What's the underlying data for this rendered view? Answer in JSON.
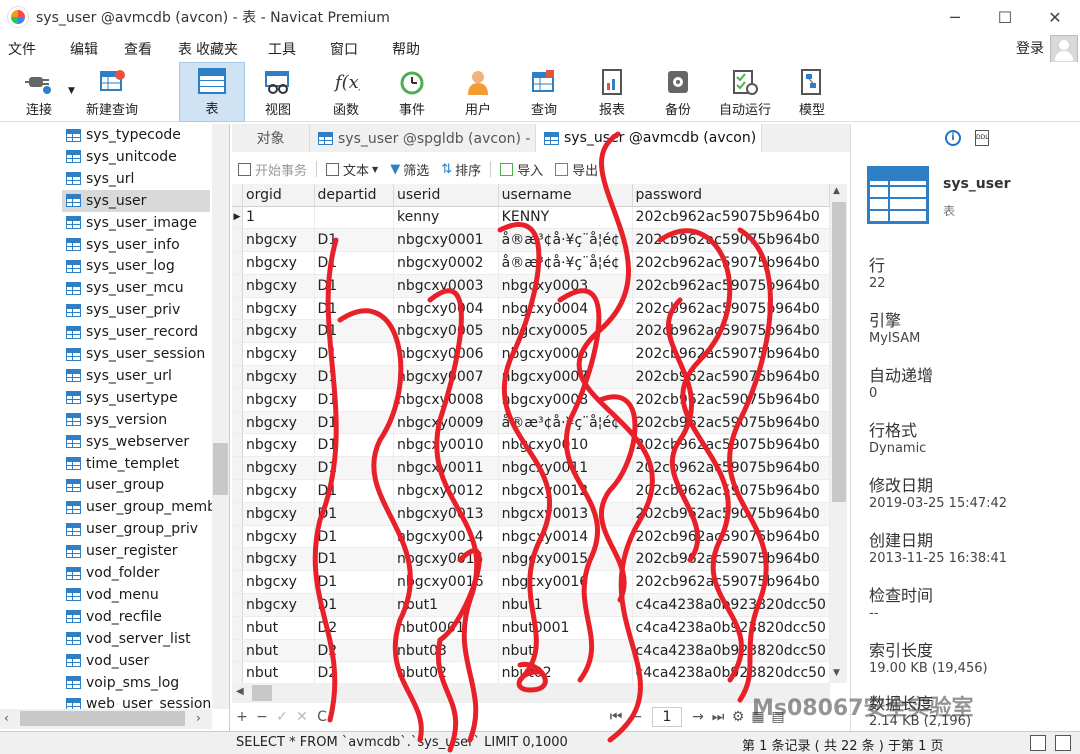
{
  "window": {
    "title": "sys_user @avmcdb (avcon) - 表 - Navicat Premium",
    "controls": [
      "─",
      "☐",
      "✕"
    ]
  },
  "menu": [
    "文件",
    "编辑",
    "查看",
    "表",
    "收藏夹",
    "工具",
    "窗口",
    "帮助"
  ],
  "login_label": "登录",
  "toolbar": [
    {
      "label": "连接",
      "icon": "plug-icon"
    },
    {
      "label": "新建查询",
      "icon": "new-query-icon"
    },
    {
      "label": "表",
      "icon": "table-icon",
      "active": true
    },
    {
      "label": "视图",
      "icon": "view-icon"
    },
    {
      "label": "函数",
      "icon": "function-icon"
    },
    {
      "label": "事件",
      "icon": "clock-icon"
    },
    {
      "label": "用户",
      "icon": "user-icon"
    },
    {
      "label": "查询",
      "icon": "query-icon"
    },
    {
      "label": "报表",
      "icon": "report-icon"
    },
    {
      "label": "备份",
      "icon": "backup-icon"
    },
    {
      "label": "自动运行",
      "icon": "auto-run-icon"
    },
    {
      "label": "模型",
      "icon": "model-icon"
    }
  ],
  "sidebar": {
    "items": [
      "sys_typecode",
      "sys_unitcode",
      "sys_url",
      "sys_user",
      "sys_user_image",
      "sys_user_info",
      "sys_user_log",
      "sys_user_mcu",
      "sys_user_priv",
      "sys_user_record",
      "sys_user_session",
      "sys_user_url",
      "sys_usertype",
      "sys_version",
      "sys_webserver",
      "time_templet",
      "user_group",
      "user_group_memb",
      "user_group_priv",
      "user_register",
      "vod_folder",
      "vod_menu",
      "vod_recfile",
      "vod_server_list",
      "vod_user",
      "voip_sms_log",
      "web_user_session"
    ],
    "selected": "sys_user"
  },
  "tabs": [
    "对象",
    "sys_user @spgldb (avcon) - 表",
    "sys_user @avmcdb (avcon) -..."
  ],
  "data_toolbar": [
    "开始事务",
    "文本",
    "筛选",
    "排序",
    "导入",
    "导出"
  ],
  "grid": {
    "columns": [
      "orgid",
      "departid",
      "userid",
      "username",
      "password"
    ],
    "rows": [
      [
        "1",
        "",
        "kenny",
        "KENNY",
        "202cb962ac59075b964b0"
      ],
      [
        "nbgcxy",
        "D1",
        "nbgcxy0001",
        "å®æ³¢å·¥ç¨å­¦é¢",
        "202cb962ac59075b964b0"
      ],
      [
        "nbgcxy",
        "D1",
        "nbgcxy0002",
        "å®æ³¢å·¥ç¨å­¦é¢",
        "202cb962ac59075b964b0"
      ],
      [
        "nbgcxy",
        "D1",
        "nbgcxy0003",
        "nbgcxy0003",
        "202cb962ac59075b964b0"
      ],
      [
        "nbgcxy",
        "D1",
        "nbgcxy0004",
        "nbgcxy0004",
        "202cb962ac59075b964b0"
      ],
      [
        "nbgcxy",
        "D1",
        "nbgcxy0005",
        "nbgcxy0005",
        "202cb962ac59075b964b0"
      ],
      [
        "nbgcxy",
        "D1",
        "nbgcxy0006",
        "nbgcxy0006",
        "202cb962ac59075b964b0"
      ],
      [
        "nbgcxy",
        "D1",
        "nbgcxy0007",
        "nbgcxy0007",
        "202cb962ac59075b964b0"
      ],
      [
        "nbgcxy",
        "D1",
        "nbgcxy0008",
        "nbgcxy0008",
        "202cb962ac59075b964b0"
      ],
      [
        "nbgcxy",
        "D1",
        "nbgcxy0009",
        "å®æ³¢å·¥ç¨å­¦é¢",
        "202cb962ac59075b964b0"
      ],
      [
        "nbgcxy",
        "D1",
        "nbgcxy0010",
        "nbgcxy0010",
        "202cb962ac59075b964b0"
      ],
      [
        "nbgcxy",
        "D1",
        "nbgcxy0011",
        "nbgcxy0011",
        "202cb962ac59075b964b0"
      ],
      [
        "nbgcxy",
        "D1",
        "nbgcxy0012",
        "nbgcxy0012",
        "202cb962ac59075b964b0"
      ],
      [
        "nbgcxy",
        "D1",
        "nbgcxy0013",
        "nbgcxy0013",
        "202cb962ac59075b964b0"
      ],
      [
        "nbgcxy",
        "D1",
        "nbgcxy0014",
        "nbgcxy0014",
        "202cb962ac59075b964b0"
      ],
      [
        "nbgcxy",
        "D1",
        "nbgcxy0015",
        "nbgcxy0015",
        "202cb962ac59075b964b0"
      ],
      [
        "nbgcxy",
        "D1",
        "nbgcxy0016",
        "nbgcxy0016",
        "202cb962ac59075b964b0"
      ],
      [
        "nbgcxy",
        "D1",
        "nbut1",
        "nbut1",
        "c4ca4238a0b923820dcc50"
      ],
      [
        "nbut",
        "D2",
        "nbut0001",
        "nbut0001",
        "c4ca4238a0b923820dcc50"
      ],
      [
        "nbut",
        "D2",
        "nbut03",
        "nbut",
        "c4ca4238a0b923820dcc50"
      ],
      [
        "nbut",
        "D2",
        "nbut02",
        "nbut02",
        "c4ca4238a0b923820dcc50"
      ]
    ]
  },
  "bottom_nav": {
    "page": "1",
    "buttons": [
      "+",
      "−",
      "✓",
      "✕",
      "C"
    ]
  },
  "status": {
    "sql": "SELECT * FROM `avmcdb`.`sys_user` LIMIT 0,1000",
    "records": "第 1 条记录 ( 共 22 条 ) 于第 1 页"
  },
  "info_panel": {
    "name": "sys_user",
    "type": "表",
    "props": [
      {
        "label": "行",
        "value": "22"
      },
      {
        "label": "引擎",
        "value": "MyISAM"
      },
      {
        "label": "自动递增",
        "value": "0"
      },
      {
        "label": "行格式",
        "value": "Dynamic"
      },
      {
        "label": "修改日期",
        "value": "2019-03-25 15:47:42"
      },
      {
        "label": "创建日期",
        "value": "2013-11-25 16:38:41"
      },
      {
        "label": "检查时间",
        "value": "--"
      },
      {
        "label": "索引长度",
        "value": "19.00 KB (19,456)"
      },
      {
        "label": "数据长度",
        "value": "2.14 KB (2,196)"
      }
    ]
  },
  "watermark": "Ms08067安全实验室",
  "colors": {
    "accent": "#2f7fc7",
    "scribble": "#e8202a",
    "selected_tool": "#cfe3f5"
  }
}
